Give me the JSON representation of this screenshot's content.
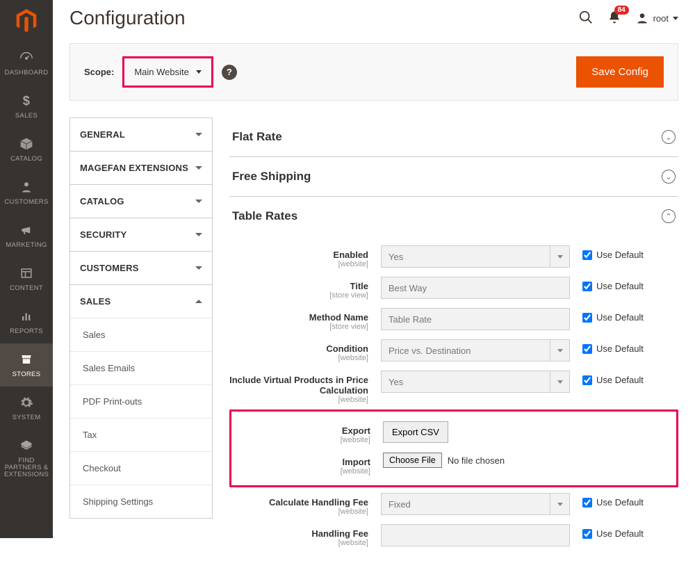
{
  "pageTitle": "Configuration",
  "notifications": {
    "count": "84"
  },
  "user": {
    "name": "root"
  },
  "scope": {
    "label": "Scope:",
    "value": "Main Website"
  },
  "saveBtn": "Save Config",
  "adminNav": [
    {
      "id": "dashboard",
      "label": "DASHBOARD"
    },
    {
      "id": "sales",
      "label": "SALES"
    },
    {
      "id": "catalog",
      "label": "CATALOG"
    },
    {
      "id": "customers",
      "label": "CUSTOMERS"
    },
    {
      "id": "marketing",
      "label": "MARKETING"
    },
    {
      "id": "content",
      "label": "CONTENT"
    },
    {
      "id": "reports",
      "label": "REPORTS"
    },
    {
      "id": "stores",
      "label": "STORES",
      "active": true
    },
    {
      "id": "system",
      "label": "SYSTEM"
    },
    {
      "id": "partners",
      "label": "FIND PARTNERS & EXTENSIONS"
    }
  ],
  "cfgTabs": [
    {
      "label": "GENERAL",
      "open": false
    },
    {
      "label": "MAGEFAN EXTENSIONS",
      "open": false
    },
    {
      "label": "CATALOG",
      "open": false
    },
    {
      "label": "SECURITY",
      "open": false
    },
    {
      "label": "CUSTOMERS",
      "open": false
    },
    {
      "label": "SALES",
      "open": true,
      "children": [
        "Sales",
        "Sales Emails",
        "PDF Print-outs",
        "Tax",
        "Checkout",
        "Shipping Settings"
      ]
    }
  ],
  "sections": {
    "flatRate": {
      "title": "Flat Rate"
    },
    "freeShip": {
      "title": "Free Shipping"
    },
    "tableRates": {
      "title": "Table Rates"
    }
  },
  "tableRates": {
    "useDefault": "Use Default",
    "fields": {
      "enabled": {
        "label": "Enabled",
        "scope": "[website]",
        "value": "Yes"
      },
      "title": {
        "label": "Title",
        "scope": "[store view]",
        "value": "Best Way"
      },
      "method": {
        "label": "Method Name",
        "scope": "[store view]",
        "value": "Table Rate"
      },
      "condition": {
        "label": "Condition",
        "scope": "[website]",
        "value": "Price vs. Destination"
      },
      "virtual": {
        "label": "Include Virtual Products in Price Calculation",
        "scope": "[website]",
        "value": "Yes"
      },
      "export": {
        "label": "Export",
        "scope": "[website]",
        "button": "Export CSV"
      },
      "import": {
        "label": "Import",
        "scope": "[website]",
        "button": "Choose File",
        "status": "No file chosen"
      },
      "calcfee": {
        "label": "Calculate Handling Fee",
        "scope": "[website]",
        "value": "Fixed"
      },
      "handfee": {
        "label": "Handling Fee",
        "scope": "[website]",
        "value": ""
      }
    }
  }
}
